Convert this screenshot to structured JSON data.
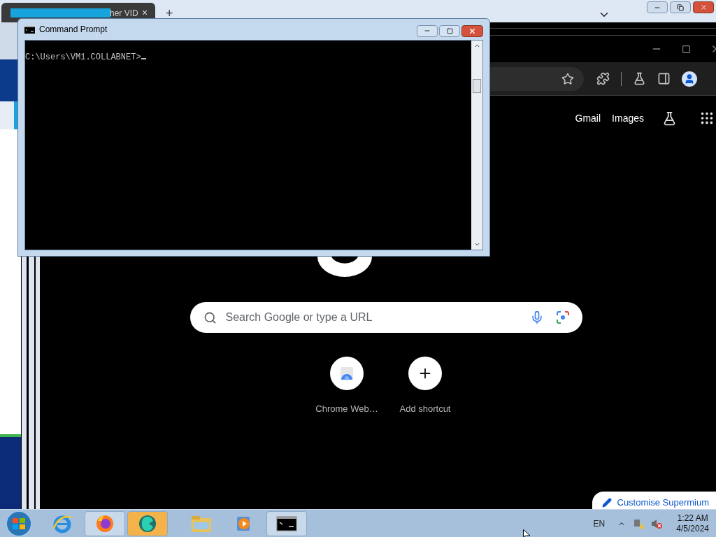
{
  "background_window": {
    "tab_title": "her VID",
    "tab_close": "×",
    "new_tab": "+"
  },
  "cmd_window": {
    "title": "Command Prompt",
    "prompt": "C:\\Users\\VM1.COLLABNET>"
  },
  "browser": {
    "top_links": [
      "Gmail",
      "Images"
    ],
    "search": {
      "placeholder": "Search Google or type a URL"
    },
    "shortcuts": [
      {
        "label": "Chrome Web…",
        "kind": "webstore"
      },
      {
        "label": "Add shortcut",
        "kind": "add"
      }
    ],
    "customise": "Customise Supermium"
  },
  "taskbar": {
    "apps": [
      {
        "kind": "ie",
        "running": false,
        "selected": false
      },
      {
        "kind": "firefox",
        "running": true,
        "selected": false
      },
      {
        "kind": "player",
        "running": true,
        "selected": true
      },
      {
        "kind": "explorer",
        "running": false,
        "selected": false
      },
      {
        "kind": "media",
        "running": false,
        "selected": false
      },
      {
        "kind": "cmd",
        "running": true,
        "selected": false
      }
    ],
    "language": "EN",
    "time": "1:22 AM",
    "date": "4/5/2024"
  }
}
